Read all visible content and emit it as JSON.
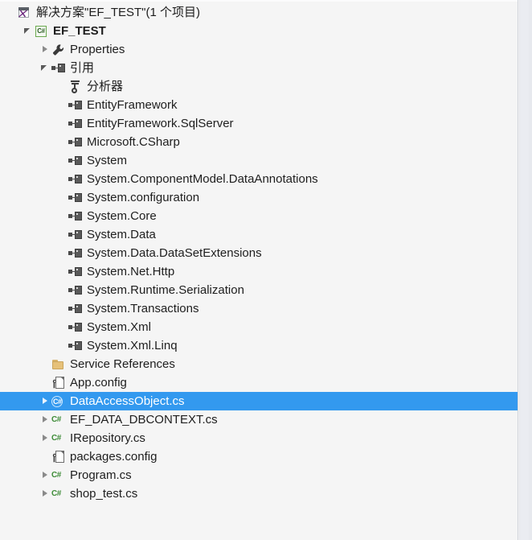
{
  "window": {
    "title": "Solution Explorer",
    "background_color": "#f5f5f5",
    "selection_color": "#3399ef",
    "text_color": "#1e1e1e"
  },
  "tree": {
    "nodes": [
      {
        "label": "解决方案\"EF_TEST\"(1 个项目)",
        "icon": "solution-icon",
        "indent": 0,
        "twisty": "none",
        "bold": false,
        "selected": false
      },
      {
        "label": "EF_TEST",
        "icon": "csharp-project-icon",
        "indent": 1,
        "twisty": "expanded",
        "bold": true,
        "selected": false
      },
      {
        "label": "Properties",
        "icon": "wrench-icon",
        "indent": 2,
        "twisty": "collapsed",
        "bold": false,
        "selected": false
      },
      {
        "label": "引用",
        "icon": "references-icon",
        "indent": 2,
        "twisty": "expanded",
        "bold": false,
        "selected": false
      },
      {
        "label": "分析器",
        "icon": "analyzer-icon",
        "indent": 3,
        "twisty": "none",
        "bold": false,
        "selected": false
      },
      {
        "label": "EntityFramework",
        "icon": "reference-icon",
        "indent": 3,
        "twisty": "none",
        "bold": false,
        "selected": false
      },
      {
        "label": "EntityFramework.SqlServer",
        "icon": "reference-icon",
        "indent": 3,
        "twisty": "none",
        "bold": false,
        "selected": false
      },
      {
        "label": "Microsoft.CSharp",
        "icon": "reference-icon",
        "indent": 3,
        "twisty": "none",
        "bold": false,
        "selected": false
      },
      {
        "label": "System",
        "icon": "reference-icon",
        "indent": 3,
        "twisty": "none",
        "bold": false,
        "selected": false
      },
      {
        "label": "System.ComponentModel.DataAnnotations",
        "icon": "reference-icon",
        "indent": 3,
        "twisty": "none",
        "bold": false,
        "selected": false
      },
      {
        "label": "System.configuration",
        "icon": "reference-icon",
        "indent": 3,
        "twisty": "none",
        "bold": false,
        "selected": false
      },
      {
        "label": "System.Core",
        "icon": "reference-icon",
        "indent": 3,
        "twisty": "none",
        "bold": false,
        "selected": false
      },
      {
        "label": "System.Data",
        "icon": "reference-icon",
        "indent": 3,
        "twisty": "none",
        "bold": false,
        "selected": false
      },
      {
        "label": "System.Data.DataSetExtensions",
        "icon": "reference-icon",
        "indent": 3,
        "twisty": "none",
        "bold": false,
        "selected": false
      },
      {
        "label": "System.Net.Http",
        "icon": "reference-icon",
        "indent": 3,
        "twisty": "none",
        "bold": false,
        "selected": false
      },
      {
        "label": "System.Runtime.Serialization",
        "icon": "reference-icon",
        "indent": 3,
        "twisty": "none",
        "bold": false,
        "selected": false
      },
      {
        "label": "System.Transactions",
        "icon": "reference-icon",
        "indent": 3,
        "twisty": "none",
        "bold": false,
        "selected": false
      },
      {
        "label": "System.Xml",
        "icon": "reference-icon",
        "indent": 3,
        "twisty": "none",
        "bold": false,
        "selected": false
      },
      {
        "label": "System.Xml.Linq",
        "icon": "reference-icon",
        "indent": 3,
        "twisty": "none",
        "bold": false,
        "selected": false
      },
      {
        "label": "Service References",
        "icon": "folder-icon",
        "indent": 2,
        "twisty": "none",
        "bold": false,
        "selected": false
      },
      {
        "label": "App.config",
        "icon": "config-file-icon",
        "indent": 2,
        "twisty": "none",
        "bold": false,
        "selected": false
      },
      {
        "label": "DataAccessObject.cs",
        "icon": "csharp-class-icon",
        "indent": 2,
        "twisty": "collapsed",
        "bold": false,
        "selected": true
      },
      {
        "label": "EF_DATA_DBCONTEXT.cs",
        "icon": "csharp-file-icon",
        "indent": 2,
        "twisty": "collapsed",
        "bold": false,
        "selected": false
      },
      {
        "label": "IRepository.cs",
        "icon": "csharp-file-icon",
        "indent": 2,
        "twisty": "collapsed",
        "bold": false,
        "selected": false
      },
      {
        "label": "packages.config",
        "icon": "config-file-icon",
        "indent": 2,
        "twisty": "none",
        "bold": false,
        "selected": false
      },
      {
        "label": "Program.cs",
        "icon": "csharp-file-icon",
        "indent": 2,
        "twisty": "collapsed",
        "bold": false,
        "selected": false
      },
      {
        "label": "shop_test.cs",
        "icon": "csharp-file-icon",
        "indent": 2,
        "twisty": "collapsed",
        "bold": false,
        "selected": false
      }
    ]
  }
}
